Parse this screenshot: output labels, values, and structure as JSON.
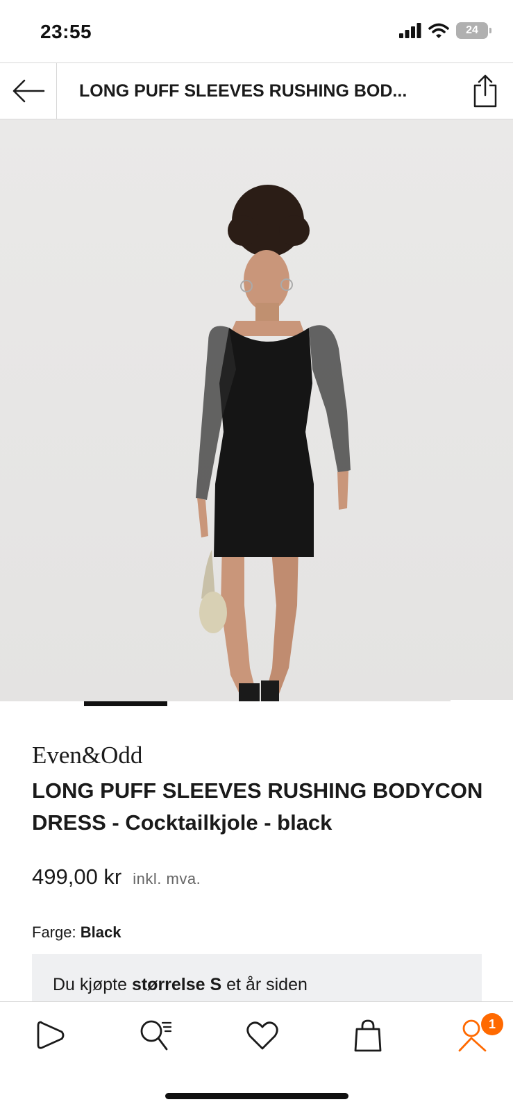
{
  "status_bar": {
    "time": "23:55",
    "battery": "24"
  },
  "header": {
    "title": "LONG PUFF SLEEVES RUSHING BOD..."
  },
  "gallery": {
    "current_image": 1
  },
  "product": {
    "brand": "Even&Odd",
    "name": "LONG PUFF SLEEVES RUSHING BODYCON DRESS - Cocktailkjole - black",
    "price": "499,00 kr",
    "vat_note": "inkl. mva.",
    "color_label": "Farge:",
    "color_value": "Black",
    "purchase_prefix": "Du kjøpte",
    "purchase_size": "størrelse S",
    "purchase_suffix": "et år siden"
  },
  "nav": {
    "account_badge": "1"
  },
  "colors": {
    "accent": "#ff6900",
    "dark": "#1a1a1a",
    "image_bg": "#ecebea"
  },
  "icons": [
    "back-arrow-icon",
    "share-icon",
    "heart-icon",
    "shopping-bag-icon",
    "play-icon",
    "search-list-icon",
    "user-icon"
  ]
}
